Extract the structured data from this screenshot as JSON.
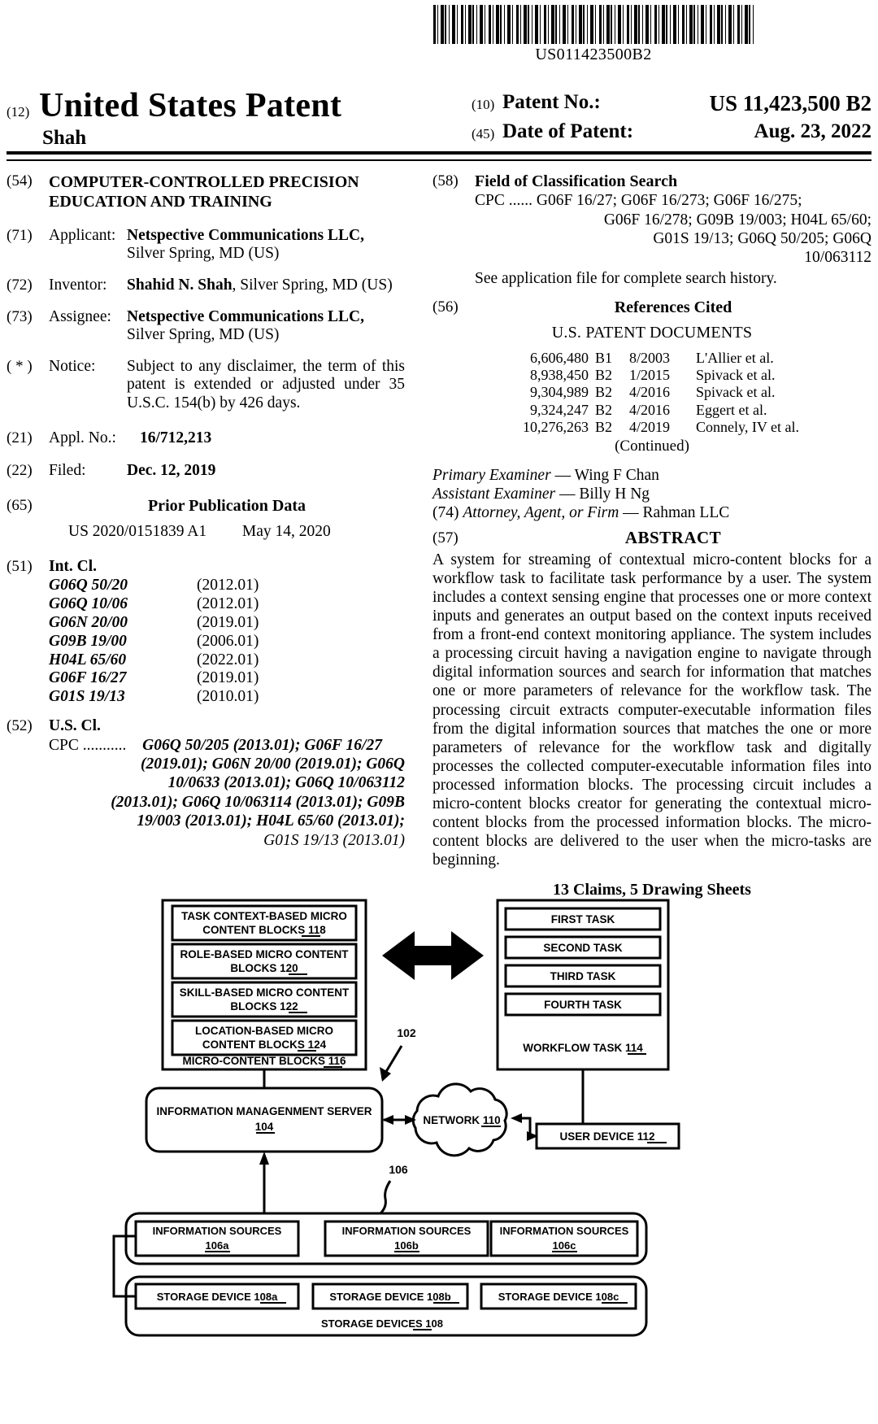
{
  "header": {
    "barcode_number": "US011423500B2",
    "kind_code_12": "(12)",
    "doc_title": "United States Patent",
    "inventor_surname": "Shah",
    "patent_no_code": "(10)",
    "patent_no_label": "Patent No.:",
    "patent_no_value": "US 11,423,500 B2",
    "date_code": "(45)",
    "date_label": "Date of Patent:",
    "date_value": "Aug. 23, 2022"
  },
  "left": {
    "title_code": "(54)",
    "title": "COMPUTER-CONTROLLED PRECISION EDUCATION AND TRAINING",
    "applicant_code": "(71)",
    "applicant_label": "Applicant:",
    "applicant_name": "Netspective Communications LLC,",
    "applicant_addr": "Silver Spring, MD (US)",
    "inventor_code": "(72)",
    "inventor_label": "Inventor:",
    "inventor_name": "Shahid N. Shah",
    "inventor_addr": ", Silver Spring, MD (US)",
    "assignee_code": "(73)",
    "assignee_label": "Assignee:",
    "assignee_name": "Netspective Communications LLC,",
    "assignee_addr": "Silver Spring, MD (US)",
    "notice_code": "( * )",
    "notice_label": "Notice:",
    "notice_text": "Subject to any disclaimer, the term of this patent is extended or adjusted under 35 U.S.C. 154(b) by 426 days.",
    "appl_code": "(21)",
    "appl_label": "Appl. No.:",
    "appl_value": "16/712,213",
    "filed_code": "(22)",
    "filed_label": "Filed:",
    "filed_value": "Dec. 12, 2019",
    "prior_pub_code": "(65)",
    "prior_pub_heading": "Prior Publication Data",
    "prior_pub_number": "US 2020/0151839 A1",
    "prior_pub_date": "May 14, 2020",
    "intcl_code": "(51)",
    "intcl_heading": "Int. Cl.",
    "intcl_rows": [
      {
        "symbol": "G06Q 50/20",
        "edition": "(2012.01)"
      },
      {
        "symbol": "G06Q 10/06",
        "edition": "(2012.01)"
      },
      {
        "symbol": "G06N 20/00",
        "edition": "(2019.01)"
      },
      {
        "symbol": "G09B 19/00",
        "edition": "(2006.01)"
      },
      {
        "symbol": "H04L 65/60",
        "edition": "(2022.01)"
      },
      {
        "symbol": "G06F 16/27",
        "edition": "(2019.01)"
      },
      {
        "symbol": "G01S 19/13",
        "edition": "(2010.01)"
      }
    ],
    "uscl_code": "(52)",
    "uscl_heading": "U.S. Cl.",
    "uscl_cpc_prefix": "CPC ...........",
    "uscl_lines": [
      "G06Q 50/205 (2013.01); G06F 16/27",
      "(2019.01); G06N 20/00 (2019.01); G06Q",
      "10/0633 (2013.01); G06Q 10/063112",
      "(2013.01); G06Q 10/063114 (2013.01); G09B",
      "19/003 (2013.01); H04L 65/60 (2013.01);",
      "G01S 19/13 (2013.01)"
    ]
  },
  "right": {
    "fcs_code": "(58)",
    "fcs_heading": "Field of Classification Search",
    "fcs_prefix": "CPC ......",
    "fcs_lines": [
      "G06F 16/27; G06F 16/273; G06F 16/275;",
      "G06F 16/278; G09B 19/003; H04L 65/60;",
      "G01S 19/13; G06Q 50/205; G06Q",
      "10/063112"
    ],
    "fcs_see": "See application file for complete search history.",
    "refs_code": "(56)",
    "refs_heading": "References Cited",
    "refs_subheading": "U.S. PATENT DOCUMENTS",
    "references": [
      {
        "number": "6,606,480",
        "kind": "B1",
        "date": "8/2003",
        "assignee": "L'Allier et al."
      },
      {
        "number": "8,938,450",
        "kind": "B2",
        "date": "1/2015",
        "assignee": "Spivack et al."
      },
      {
        "number": "9,304,989",
        "kind": "B2",
        "date": "4/2016",
        "assignee": "Spivack et al."
      },
      {
        "number": "9,324,247",
        "kind": "B2",
        "date": "4/2016",
        "assignee": "Eggert et al."
      },
      {
        "number": "10,276,263",
        "kind": "B2",
        "date": "4/2019",
        "assignee": "Connely, IV et al."
      }
    ],
    "continued": "(Continued)",
    "primary_examiner_label": "Primary Examiner",
    "primary_examiner_name": "Wing F Chan",
    "assistant_examiner_label": "Assistant Examiner",
    "assistant_examiner_name": "Billy H Ng",
    "attorney_code": "(74)",
    "attorney_label": "Attorney, Agent, or Firm",
    "attorney_name": "Rahman LLC",
    "abstract_code": "(57)",
    "abstract_heading": "ABSTRACT",
    "abstract_text": "A system for streaming of contextual micro-content blocks for a workflow task to facilitate task performance by a user. The system includes a context sensing engine that processes one or more context inputs and generates an output based on the context inputs received from a front-end context monitoring appliance. The system includes a processing circuit having a navigation engine to navigate through digital information sources and search for information that matches one or more parameters of relevance for the workflow task. The processing circuit extracts computer-executable information files from the digital information sources that matches the one or more parameters of relevance for the workflow task and digitally processes the collected computer-executable information files into processed information blocks. The processing circuit includes a micro-content blocks creator for generating the contextual micro-content blocks from the processed information blocks. The micro-content blocks are delivered to the user when the micro-tasks are beginning.",
    "claims_sheets": "13 Claims, 5 Drawing Sheets"
  },
  "figure": {
    "micro_content_blocks_group": "MICRO-CONTENT BLOCKS 116",
    "blocks": [
      {
        "line1": "TASK CONTEXT-BASED MICRO",
        "line2": "CONTENT BLOCKS 118"
      },
      {
        "line1": "ROLE-BASED MICRO CONTENT",
        "line2": "BLOCKS 120"
      },
      {
        "line1": "SKILL-BASED MICRO CONTENT",
        "line2": "BLOCKS 122"
      },
      {
        "line1": "LOCATION-BASED MICRO",
        "line2": "CONTENT BLOCKS 124"
      }
    ],
    "workflow_group": "WORKFLOW TASK 114",
    "tasks": [
      "FIRST TASK",
      "SECOND TASK",
      "THIRD TASK",
      "FOURTH TASK"
    ],
    "server": {
      "line1": "INFORMATION MANAGENMENT SERVER",
      "line2": "104"
    },
    "network": "NETWORK 110",
    "user_device": "USER DEVICE 112",
    "info_sources": [
      "INFORMATION SOURCES 106a",
      "INFORMATION SOURCES 106b",
      "INFORMATION SOURCES 106c"
    ],
    "storage_devices": [
      "STORAGE DEVICE 108a",
      "STORAGE DEVICE 108b",
      "STORAGE DEVICE 108c"
    ],
    "storage_group": "STORAGE DEVICES 108",
    "ref_102": "102",
    "ref_106": "106"
  }
}
